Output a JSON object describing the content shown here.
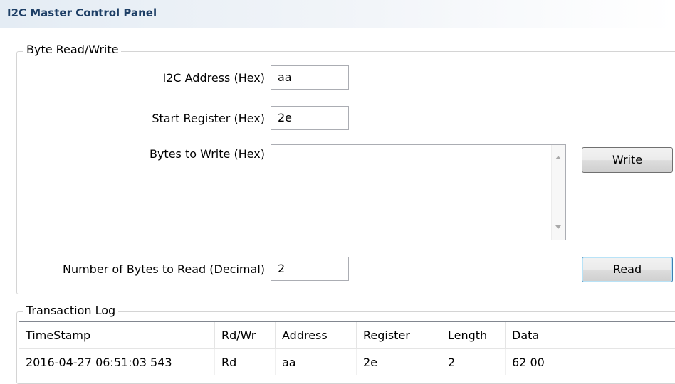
{
  "panel": {
    "title": "I2C Master Control Panel"
  },
  "byte_rw": {
    "legend": "Byte Read/Write",
    "address_label": "I2C Address (Hex)",
    "address_value": "aa",
    "start_register_label": "Start Register (Hex)",
    "start_register_value": "2e",
    "bytes_to_write_label": "Bytes to Write (Hex)",
    "bytes_to_write_value": "",
    "write_button": "Write",
    "num_bytes_label": "Number of Bytes to Read (Decimal)",
    "num_bytes_value": "2",
    "read_button": "Read"
  },
  "log": {
    "legend": "Transaction Log",
    "columns": [
      "TimeStamp",
      "Rd/Wr",
      "Address",
      "Register",
      "Length",
      "Data"
    ],
    "rows": [
      [
        "2016-04-27 06:51:03 543",
        "Rd",
        "aa",
        "2e",
        "2",
        "62 00"
      ]
    ]
  },
  "icons": {
    "scroll_up": "scroll-up-arrow-icon",
    "scroll_down": "scroll-down-arrow-icon"
  }
}
